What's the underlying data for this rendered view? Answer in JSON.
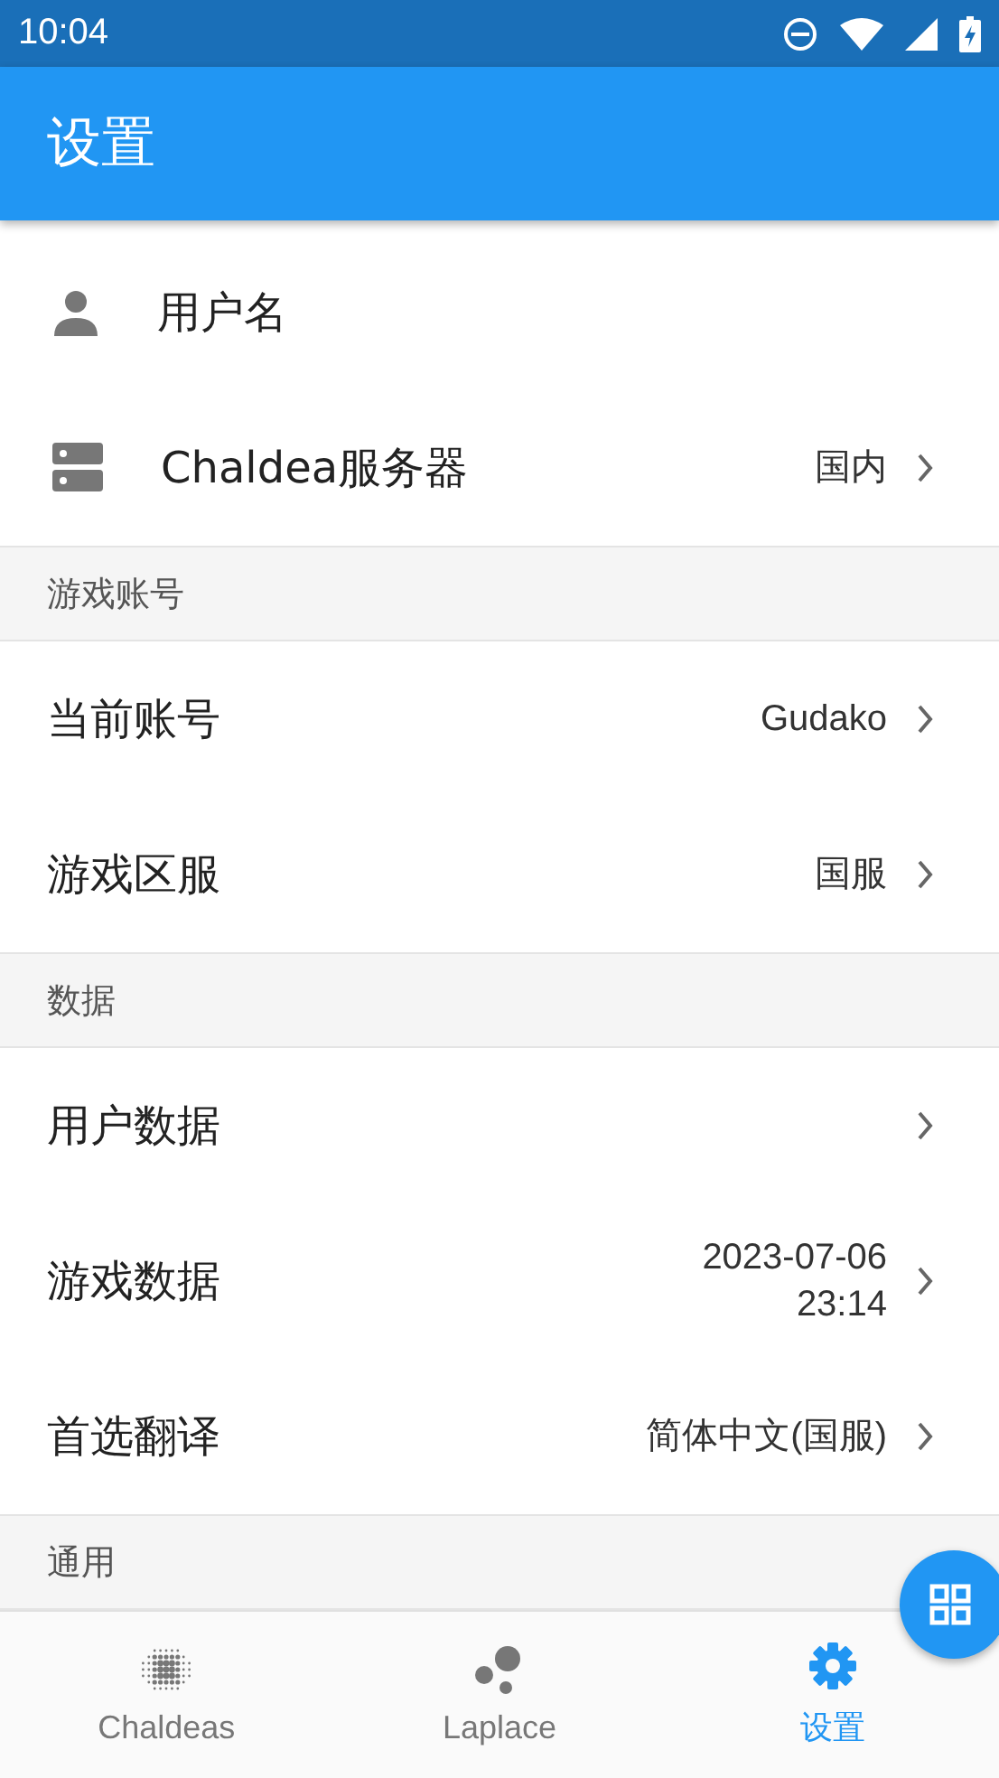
{
  "status_bar": {
    "time": "10:04"
  },
  "app_bar": {
    "title": "设置"
  },
  "sections": [
    {
      "items": [
        {
          "kind": "account",
          "label": "用户名",
          "arrow": false
        },
        {
          "kind": "server",
          "label": "Chaldea服务器",
          "value": "国内",
          "arrow": true
        }
      ]
    },
    {
      "header": "游戏账号",
      "items": [
        {
          "kind": "plain",
          "label": "当前账号",
          "value": "Gudako",
          "arrow": true
        },
        {
          "kind": "plain",
          "label": "游戏区服",
          "value": "国服",
          "arrow": true
        }
      ]
    },
    {
      "header": "数据",
      "items": [
        {
          "kind": "plain",
          "label": "用户数据",
          "arrow": true
        },
        {
          "kind": "plain",
          "label": "游戏数据",
          "value": "2023-07-06\n23:14",
          "arrow": true
        },
        {
          "kind": "plain",
          "label": "首选翻译",
          "value": "简体中文(国服)",
          "arrow": true
        }
      ]
    },
    {
      "header": "通用"
    }
  ],
  "bottom_nav": [
    {
      "kind": "chaldeas",
      "label": "Chaldeas",
      "selected": false
    },
    {
      "kind": "laplace",
      "label": "Laplace",
      "selected": false
    },
    {
      "kind": "settings",
      "label": "设置",
      "selected": true
    }
  ]
}
